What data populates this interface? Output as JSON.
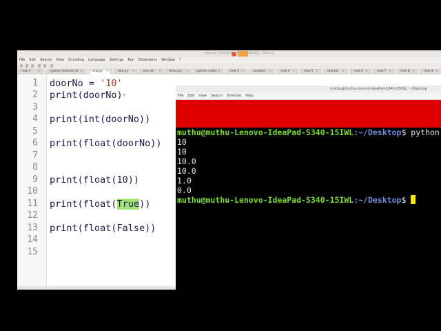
{
  "editor": {
    "title": "new.py [/home/muthu/Desktop] - Geany",
    "menu": [
      "File",
      "Edit",
      "Search",
      "View",
      "Encoding",
      "Language",
      "Settings",
      "Run",
      "Extensions",
      "Window",
      "?"
    ],
    "tabs": [
      "new 2",
      "python tutorial.txt",
      "new.py",
      "two.py",
      "one.txt",
      "three.py",
      "python notes",
      "new 3",
      "answers",
      "new 4",
      "new 5",
      "one.txt",
      "new 6",
      "new 7",
      "new 8",
      "new 9"
    ],
    "active_tab": 2,
    "line_numbers": [
      "1",
      "2",
      "3",
      "4",
      "5",
      "6",
      "7",
      "8",
      "9",
      "10",
      "11",
      "12",
      "13",
      "14",
      "15"
    ],
    "lines": {
      "l1_pre": "doorNo = ",
      "l1_str": "'10'",
      "l2": "print(doorNo)",
      "l4": "print(int(doorNo))",
      "l6": "print(float(doorNo))",
      "l9": "print(float(10))",
      "l11_pre": "print(float(",
      "l11_hl": "True",
      "l11_post": "))",
      "l13": "print(float(False))"
    }
  },
  "terminal": {
    "title": "muthu@muthu-Lenovo-IdeaPad-S340-15IWL: ~/Desktop",
    "menu": [
      "File",
      "Edit",
      "View",
      "Search",
      "Terminal",
      "Help"
    ],
    "prompt_user": "muthu@muthu-Lenovo-IdeaPad-S340-15IWL",
    "prompt_path": ":~/Desktop",
    "prompt_suffix": "$ ",
    "command": "python",
    "output": [
      "10",
      "10",
      "10.0",
      "10.0",
      "1.0",
      "0.0"
    ]
  },
  "colors": {
    "prompt_user": "#7cdb2c",
    "prompt_path": "#6f8fd8",
    "highlight": "#a6e37a",
    "string": "#b9341b",
    "terminal_banner": "#e00000",
    "cursor": "#f6e60c"
  }
}
